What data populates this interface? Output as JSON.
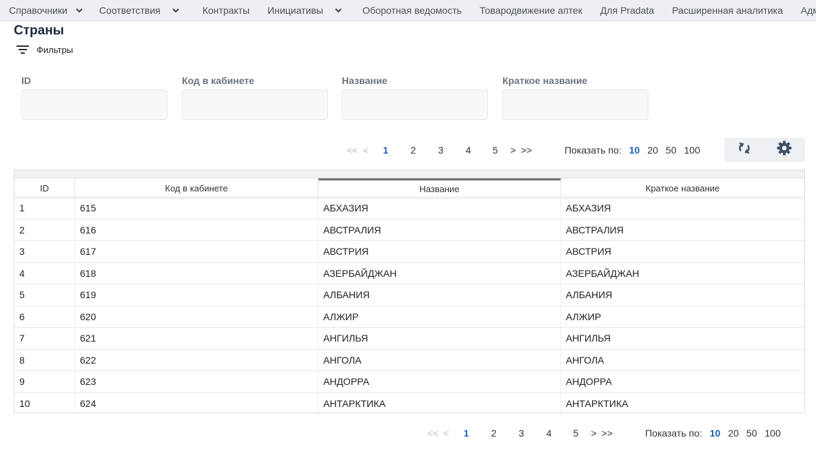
{
  "nav": {
    "items": [
      {
        "label": "Справочники",
        "dropdown": true
      },
      {
        "label": "Соответствия",
        "dropdown": true
      },
      {
        "label": "Контракты",
        "dropdown": false
      },
      {
        "label": "Инициативы",
        "dropdown": true
      },
      {
        "label": "Оборотная ведомость",
        "dropdown": false
      },
      {
        "label": "Товародвижение аптек",
        "dropdown": false
      },
      {
        "label": "Для Pradata",
        "dropdown": false
      },
      {
        "label": "Расширенная аналитика",
        "dropdown": false
      },
      {
        "label": "Админи",
        "dropdown": false
      }
    ]
  },
  "page": {
    "title": "Страны",
    "filters_label": "Фильтры"
  },
  "filters": [
    {
      "label": "ID",
      "value": ""
    },
    {
      "label": "Код в кабинете",
      "value": ""
    },
    {
      "label": "Название",
      "value": ""
    },
    {
      "label": "Краткое название",
      "value": ""
    }
  ],
  "pager": {
    "first": "<<",
    "prev": "<",
    "next": ">",
    "last": ">>",
    "pages": [
      "1",
      "2",
      "3",
      "4",
      "5"
    ],
    "current_page": "1",
    "show_label": "Показать по:",
    "sizes": [
      "10",
      "20",
      "50",
      "100"
    ],
    "current_size": "10"
  },
  "tools": {
    "refresh_icon": "refresh-icon",
    "settings_icon": "gear-icon"
  },
  "table": {
    "columns": [
      "ID",
      "Код в кабинете",
      "Название",
      "Краткое название"
    ],
    "sorted_column": "Название",
    "rows": [
      [
        "1",
        "615",
        "АБХАЗИЯ",
        "АБХАЗИЯ"
      ],
      [
        "2",
        "616",
        "АВСТРАЛИЯ",
        "АВСТРАЛИЯ"
      ],
      [
        "3",
        "617",
        "АВСТРИЯ",
        "АВСТРИЯ"
      ],
      [
        "4",
        "618",
        "АЗЕРБАЙДЖАН",
        "АЗЕРБАЙДЖАН"
      ],
      [
        "5",
        "619",
        "АЛБАНИЯ",
        "АЛБАНИЯ"
      ],
      [
        "6",
        "620",
        "АЛЖИР",
        "АЛЖИР"
      ],
      [
        "7",
        "621",
        "АНГИЛЬЯ",
        "АНГИЛЬЯ"
      ],
      [
        "8",
        "622",
        "АНГОЛА",
        "АНГОЛА"
      ],
      [
        "9",
        "623",
        "АНДОРРА",
        "АНДОРРА"
      ],
      [
        "10",
        "624",
        "АНТАРКТИКА",
        "АНТАРКТИКА"
      ]
    ]
  },
  "colors": {
    "accent": "#2060b4",
    "nav_bg": "#edeff2",
    "title": "#1b2a3b"
  }
}
